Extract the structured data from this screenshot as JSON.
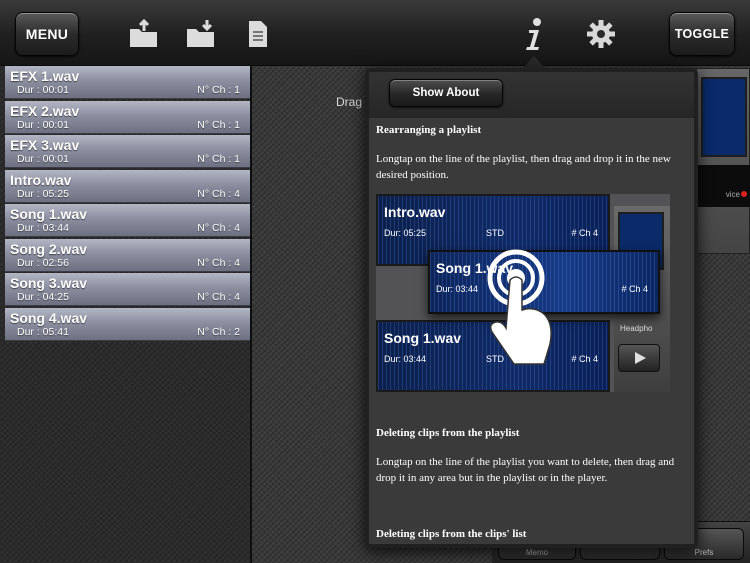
{
  "toolbar": {
    "menu_label": "MENU",
    "toggle_label": "TOGGLE",
    "icons": [
      "folder-export-icon",
      "folder-import-icon",
      "document-icon",
      "info-icon",
      "gear-icon"
    ]
  },
  "playlist": {
    "items": [
      {
        "name": "EFX 1.wav",
        "duration": "Dur : 00:01",
        "channel": "N° Ch : 1"
      },
      {
        "name": "EFX 2.wav",
        "duration": "Dur : 00:01",
        "channel": "N° Ch : 1"
      },
      {
        "name": "EFX 3.wav",
        "duration": "Dur : 00:01",
        "channel": "N° Ch : 1"
      },
      {
        "name": "Intro.wav",
        "duration": "Dur : 05:25",
        "channel": "N° Ch : 4"
      },
      {
        "name": "Song 1.wav",
        "duration": "Dur : 03:44",
        "channel": "N° Ch : 4"
      },
      {
        "name": "Song 2.wav",
        "duration": "Dur : 02:56",
        "channel": "N° Ch : 4"
      },
      {
        "name": "Song 3.wav",
        "duration": "Dur : 04:25",
        "channel": "N° Ch : 4"
      },
      {
        "name": "Song 4.wav",
        "duration": "Dur : 05:41",
        "channel": "N° Ch : 2"
      }
    ]
  },
  "background": {
    "drag_text": "Drag",
    "device_label": "vice",
    "bottom_left": "Memo",
    "bottom_right": "Prefs"
  },
  "popover": {
    "show_about_label": "Show About",
    "section1_title": "Rearranging a playlist",
    "section1_text": "Longtap on the line of the playlist, then drag and drop it in the new desired position.",
    "section2_title": "Deleting clips from the playlist",
    "section2_text": "Longtap on the line of the playlist you want to delete, then drag and drop it in any area but in the playlist or in the player.",
    "section3_title": "Deleting clips from the clips' list",
    "illustration": {
      "row1": {
        "name": "Intro.wav",
        "duration": "Dur: 05:25",
        "std": "STD",
        "channel": "# Ch 4"
      },
      "floating": {
        "name": "Song 1.wav",
        "duration": "Dur: 03:44",
        "channel": "# Ch 4"
      },
      "row2": {
        "name": "Song 1.wav",
        "duration": "Dur: 03:44",
        "std": "STD",
        "channel": "# Ch 4"
      },
      "side_label": "Headpho"
    }
  },
  "colors": {
    "playlist_item": "#8c8fa0",
    "toolbar": "#1f1f1f",
    "clip_blue": "#112a66"
  }
}
